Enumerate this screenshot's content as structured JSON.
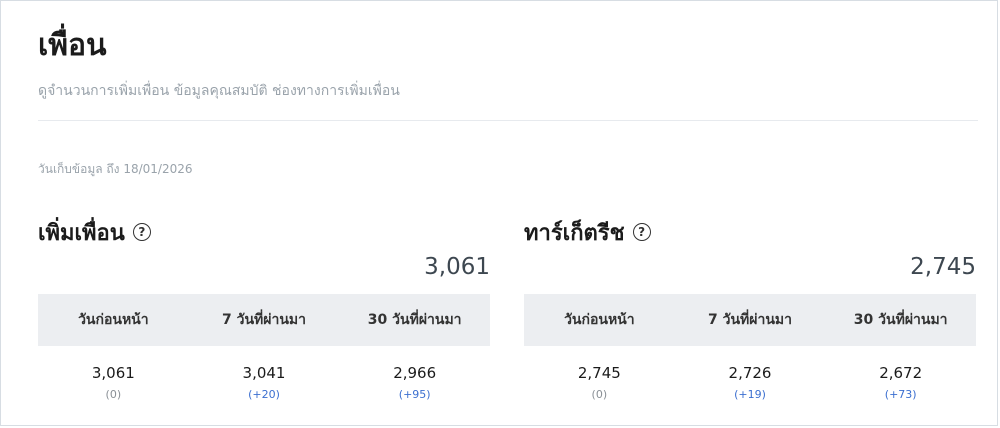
{
  "page": {
    "title": "เพื่อน",
    "subtitle": "ดูจำนวนการเพิ่มเพื่อน ข้อมูลคุณสมบัติ ช่องทางการเพิ่มเพื่อน",
    "collected": "วันเก็บข้อมูล ถึง 18/01/2026"
  },
  "panels": {
    "friends": {
      "title": "เพิ่มเพื่อน",
      "total": "3,061",
      "columns": [
        "วันก่อนหน้า",
        "7 วันที่ผ่านมา",
        "30 วันที่ผ่านมา"
      ],
      "values": [
        "3,061",
        "3,041",
        "2,966"
      ],
      "diffs": [
        "(0)",
        "(+20)",
        "(+95)"
      ]
    },
    "targeted": {
      "title": "ทาร์เก็ตรีช",
      "total": "2,745",
      "columns": [
        "วันก่อนหน้า",
        "7 วันที่ผ่านมา",
        "30 วันที่ผ่านมา"
      ],
      "values": [
        "2,745",
        "2,726",
        "2,672"
      ],
      "diffs": [
        "(0)",
        "(+19)",
        "(+73)"
      ]
    }
  },
  "icons": {
    "help": "help-circle-icon"
  },
  "colors": {
    "positive_diff": "#3b6fd0",
    "header_bg": "#eceef1"
  }
}
